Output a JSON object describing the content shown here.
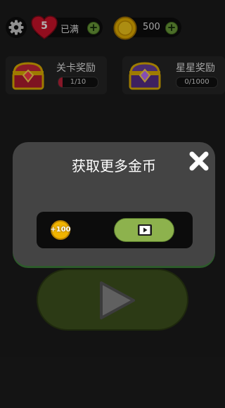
{
  "topbar": {
    "settings_icon": "gear-icon",
    "lives": {
      "count": "5",
      "status": "已满",
      "icon": "heart-icon"
    },
    "coins": {
      "amount": "500",
      "icon": "coin-icon"
    }
  },
  "rewards": [
    {
      "title": "关卡奖励",
      "progress_text": "1/10",
      "progress": 0.1,
      "icon": "red-chest-icon"
    },
    {
      "title": "星星奖励",
      "progress_text": "0/1000",
      "progress": 0,
      "icon": "purple-chest-icon"
    }
  ],
  "dialog": {
    "title": "获取更多金币",
    "close_icon": "close-icon",
    "reward_label": "+100",
    "video_icon": "video-icon"
  },
  "play_icon": "play-icon",
  "colors": {
    "background": "#1c1c1c",
    "dialog": "#444444",
    "plus_green": "#6d9e3c",
    "play_button": "#3f531f",
    "video_button": "#8db24d",
    "heart": "#d2142c",
    "coin": "#e8b200"
  }
}
